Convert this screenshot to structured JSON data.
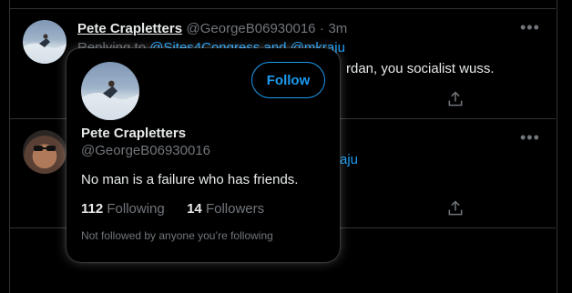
{
  "tweet1": {
    "name": "Pete Crapletters",
    "handle": "@GeorgeB06930016",
    "sep": "·",
    "time": "3m",
    "replying_prefix": "Replying to",
    "replying_to": "@Sites4Congress and @mkraju",
    "text_visible": "rdan, you socialist wuss."
  },
  "tweet2": {
    "link_fragment": "aju"
  },
  "hover_card": {
    "name": "Pete Crapletters",
    "handle": "@GeorgeB06930016",
    "follow_label": "Follow",
    "bio": "No man is a failure who has friends.",
    "following_count": "112",
    "following_label": "Following",
    "followers_count": "14",
    "followers_label": "Followers",
    "note": "Not followed by anyone you’re following"
  },
  "icons": {
    "more": "more-horizontal-icon",
    "share": "share-icon"
  },
  "colors": {
    "accent": "#1d9bf0",
    "text": "#e7e9ea",
    "secondary": "#71767b",
    "border": "#2f3336",
    "background": "#000000"
  }
}
